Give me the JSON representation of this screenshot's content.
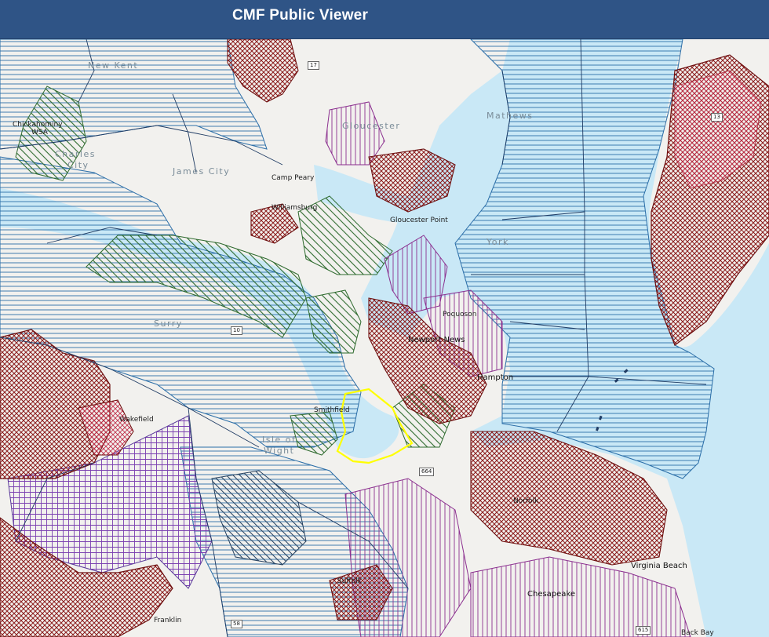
{
  "app": {
    "title": "CMF Public Viewer"
  },
  "map": {
    "colors": {
      "water": "#c9e8f6",
      "land": "#f2f1ee",
      "hatch_blue": "#2b6ea8",
      "hatch_purple": "#8b2f8f",
      "hatch_green": "#2f6b2f",
      "hatch_red": "#8b1a1a",
      "selected_outline": "#ffff00"
    },
    "labels": {
      "new_kent": "New Kent",
      "gloucester": "Gloucester",
      "mathews": "Mathews",
      "chickahominy": "Chickahominy",
      "chickahominy_2": "WSA",
      "charles_city": "Charles",
      "charles_city_2": "City",
      "james_city": "James City",
      "camp_peary": "Camp Peary",
      "williamsburg": "Williamsburg",
      "gloucester_point": "Gloucester Point",
      "york": "York",
      "surry": "Surry",
      "poquoson": "Poquoson",
      "newport_news": "Newport News",
      "hampton": "Hampton",
      "smithfield": "Smithfield",
      "wakefield": "Wakefield",
      "isle_of_wight": "Isle of",
      "isle_of_wight_2": "Wight",
      "virginia_beach": "Virginia Beach",
      "chesapeake": "Chesapeake",
      "franklin": "Franklin",
      "norfolk": "Norfolk",
      "back_bay": "Back Bay",
      "suffolk": "Suffolk"
    },
    "shields": {
      "r17": "17",
      "r10": "10",
      "r664": "664",
      "r58": "58",
      "r615": "615",
      "r13": "13"
    }
  }
}
